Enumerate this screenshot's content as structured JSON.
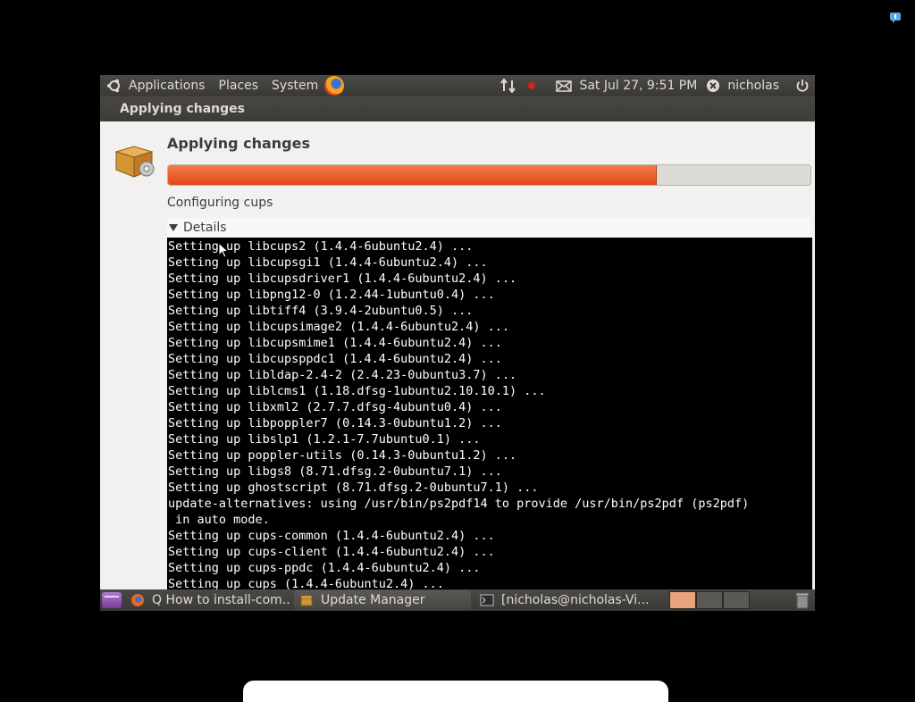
{
  "panel": {
    "menus": [
      "Applications",
      "Places",
      "System"
    ],
    "datetime": "Sat Jul 27, 9:51 PM",
    "user": "nicholas"
  },
  "window": {
    "title": "Applying changes"
  },
  "dialog": {
    "heading": "Applying changes",
    "progress_fraction": 0.76,
    "status": "Configuring cups",
    "details_label": "Details"
  },
  "terminal_lines": [
    "Setting up libcups2 (1.4.4-6ubuntu2.4) ...",
    "Setting up libcupsgi1 (1.4.4-6ubuntu2.4) ...",
    "Setting up libcupsdriver1 (1.4.4-6ubuntu2.4) ...",
    "Setting up libpng12-0 (1.2.44-1ubuntu0.4) ...",
    "Setting up libtiff4 (3.9.4-2ubuntu0.5) ...",
    "Setting up libcupsimage2 (1.4.4-6ubuntu2.4) ...",
    "Setting up libcupsmime1 (1.4.4-6ubuntu2.4) ...",
    "Setting up libcupsppdc1 (1.4.4-6ubuntu2.4) ...",
    "Setting up libldap-2.4-2 (2.4.23-0ubuntu3.7) ...",
    "Setting up liblcms1 (1.18.dfsg-1ubuntu2.10.10.1) ...",
    "Setting up libxml2 (2.7.7.dfsg-4ubuntu0.4) ...",
    "Setting up libpoppler7 (0.14.3-0ubuntu1.2) ...",
    "Setting up libslp1 (1.2.1-7.7ubuntu0.1) ...",
    "Setting up poppler-utils (0.14.3-0ubuntu1.2) ...",
    "Setting up libgs8 (8.71.dfsg.2-0ubuntu7.1) ...",
    "Setting up ghostscript (8.71.dfsg.2-0ubuntu7.1) ...",
    "update-alternatives: using /usr/bin/ps2pdf14 to provide /usr/bin/ps2pdf (ps2pdf)",
    " in auto mode.",
    "Setting up cups-common (1.4.4-6ubuntu2.4) ...",
    "Setting up cups-client (1.4.4-6ubuntu2.4) ...",
    "Setting up cups-ppdc (1.4.4-6ubuntu2.4) ...",
    "Setting up cups (1.4.4-6ubuntu2.4) ..."
  ],
  "taskbar": {
    "tasks": [
      {
        "label": "Q How to install-com...",
        "icon": "firefox-icon"
      },
      {
        "label": "Update Manager",
        "icon": "package-icon"
      },
      {
        "label": "[nicholas@nicholas-Vi...",
        "icon": "terminal-icon"
      }
    ]
  },
  "colors": {
    "progress_fill": "#e8572a",
    "panel": "#3c3b37",
    "terminal_bg": "#000000"
  }
}
